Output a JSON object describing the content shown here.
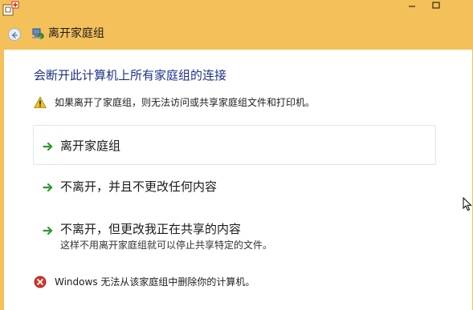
{
  "nav": {
    "title": "离开家庭组"
  },
  "main": {
    "heading": "会断开此计算机上所有家庭组的连接",
    "warning": "如果离开了家庭组，则无法访问或共享家庭组文件和打印机。",
    "options": [
      {
        "label": "离开家庭组"
      },
      {
        "label": "不离开，并且不更改任何内容"
      },
      {
        "label": "不离开，但更改我正在共享的内容",
        "sub": "这样不用离开家庭组就可以停止共享特定的文件。"
      }
    ],
    "error": "Windows 无法从该家庭组中删除你的计算机。"
  },
  "icons": {
    "app": "homegroup-app-icon",
    "back": "back-arrow-icon",
    "nav": "homegroup-icon",
    "warning": "warning-icon",
    "option_arrow": "green-arrow-icon",
    "error": "error-icon",
    "cursor": "mouse-cursor-icon"
  },
  "colors": {
    "chrome": "#f3c05a",
    "heading": "#1e3287",
    "arrow": "#2e9a2e",
    "error": "#d9342b",
    "warning": "#f0c419"
  }
}
